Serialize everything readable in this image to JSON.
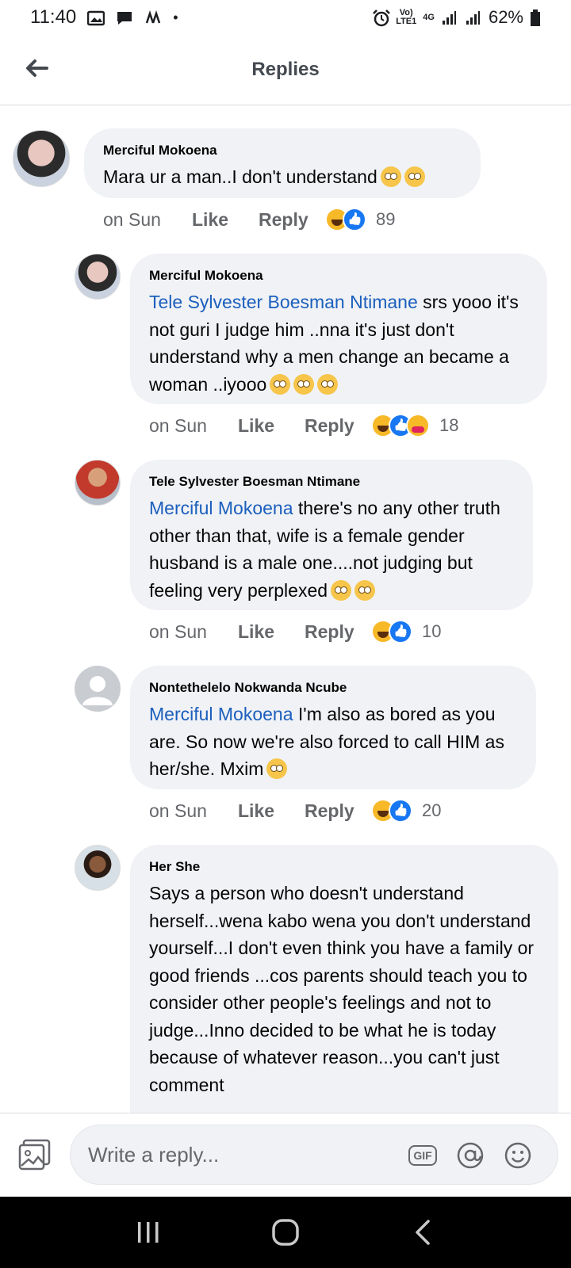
{
  "status_bar": {
    "time": "11:40",
    "network_top": "Vo)",
    "network_bottom": "LTE1",
    "signal_type": "4G",
    "battery": "62%"
  },
  "header": {
    "title": "Replies"
  },
  "comments": [
    {
      "author": "Merciful Mokoena",
      "mention": "",
      "text": "Mara ur a man..I don't understand",
      "time": "on Sun",
      "like": "Like",
      "reply": "Reply",
      "reaction_count": "89"
    },
    {
      "author": "Merciful Mokoena",
      "mention": "Tele Sylvester Boesman Ntimane",
      "text": " srs yooo it's not  guri I judge him ..nna it's just don't understand why a men change an became a woman ..iyooo",
      "time": "on Sun",
      "like": "Like",
      "reply": "Reply",
      "reaction_count": "18"
    },
    {
      "author": "Tele Sylvester Boesman Ntimane",
      "mention": "Merciful Mokoena",
      "text": " there's no any other truth other than that, wife is a female gender husband is a male one....not judging but feeling very perplexed",
      "time": "on Sun",
      "like": "Like",
      "reply": "Reply",
      "reaction_count": "10"
    },
    {
      "author": "Nontethelelo Nokwanda Ncube",
      "mention": "Merciful Mokoena",
      "text": " I'm also as bored as you are. So now we're also forced to call HIM as her/she. Mxim",
      "time": "on Sun",
      "like": "Like",
      "reply": "Reply",
      "reaction_count": "20"
    },
    {
      "author": "Her She",
      "mention": "",
      "text": "Says a person who doesn't understand herself...wena kabo wena you don't understand yourself...I don't even think you have a family or good friends ...cos parents should teach you to consider other people's feelings and not to judge...Inno decided to be what he is today because of whatever reason...you can't just comment",
      "time": "",
      "like": "",
      "reply": "",
      "reaction_count": ""
    }
  ],
  "composer": {
    "placeholder": "Write a reply...",
    "gif_label": "GIF"
  },
  "icons": {
    "back": "arrow-left-icon",
    "photo": "photo-icon",
    "gif": "gif-icon",
    "mention": "at-icon",
    "emoji": "emoji-icon",
    "recent_apps": "recent-apps-icon",
    "home": "home-icon",
    "back_nav": "chevron-left-icon"
  },
  "colors": {
    "mention": "#1b5fbd",
    "bubble": "#f0f2f5",
    "secondary_text": "#65676b",
    "like_blue": "#1877f2",
    "haha_yellow": "#f7b928"
  }
}
